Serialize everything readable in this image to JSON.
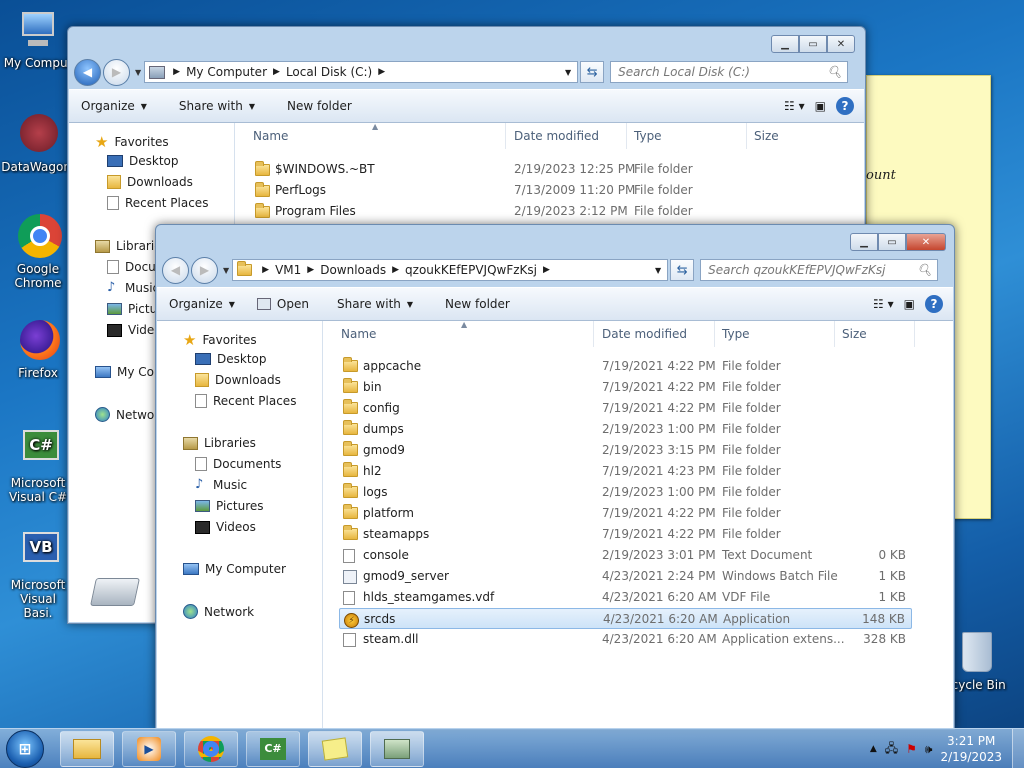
{
  "desktop": {
    "icons": [
      {
        "label": "My Comput",
        "name": "my-computer-desktop-icon"
      },
      {
        "label": "DataWagon.",
        "name": "datawagon-desktop-icon"
      },
      {
        "label": "Google Chrome",
        "name": "chrome-desktop-icon"
      },
      {
        "label": "Firefox",
        "name": "firefox-desktop-icon"
      },
      {
        "label": "Microsoft Visual C#",
        "name": "visual-csharp-desktop-icon"
      },
      {
        "label": "Microsoft Visual Basi.",
        "name": "visual-basic-desktop-icon"
      },
      {
        "label": "ecycle Bin",
        "name": "recycle-bin-desktop-icon"
      }
    ],
    "sticky_note_text": "ount"
  },
  "back_window": {
    "address": [
      "My Computer",
      "Local Disk (C:)"
    ],
    "search_placeholder": "Search Local Disk (C:)",
    "toolbar": {
      "organize": "Organize",
      "share": "Share with",
      "new_folder": "New folder"
    },
    "nav": {
      "favorites": "Favorites",
      "desktop": "Desktop",
      "downloads": "Downloads",
      "recent": "Recent Places",
      "libraries": "Librarie",
      "documents": "Docu",
      "music": "Music",
      "pictures": "Pictur",
      "videos": "Video",
      "computer": "My Cor",
      "network": "Networ"
    },
    "columns": {
      "name": "Name",
      "date": "Date modified",
      "type": "Type",
      "size": "Size"
    },
    "rows": [
      {
        "name": "$WINDOWS.~BT",
        "date": "2/19/2023 12:25 PM",
        "type": "File folder"
      },
      {
        "name": "PerfLogs",
        "date": "7/13/2009 11:20 PM",
        "type": "File folder"
      },
      {
        "name": "Program Files",
        "date": "2/19/2023 2:12 PM",
        "type": "File folder"
      }
    ]
  },
  "front_window": {
    "address": [
      "VM1",
      "Downloads",
      "qzoukKEfEPVJQwFzKsj"
    ],
    "search_placeholder": "Search qzoukKEfEPVJQwFzKsj",
    "toolbar": {
      "organize": "Organize",
      "open": "Open",
      "share": "Share with",
      "new_folder": "New folder"
    },
    "nav": {
      "favorites": "Favorites",
      "desktop": "Desktop",
      "downloads": "Downloads",
      "recent": "Recent Places",
      "libraries": "Libraries",
      "documents": "Documents",
      "music": "Music",
      "pictures": "Pictures",
      "videos": "Videos",
      "computer": "My Computer",
      "network": "Network"
    },
    "columns": {
      "name": "Name",
      "date": "Date modified",
      "type": "Type",
      "size": "Size"
    },
    "rows": [
      {
        "name": "appcache",
        "date": "7/19/2021 4:22 PM",
        "type": "File folder",
        "size": "",
        "icon": "folder"
      },
      {
        "name": "bin",
        "date": "7/19/2021 4:22 PM",
        "type": "File folder",
        "size": "",
        "icon": "folder"
      },
      {
        "name": "config",
        "date": "7/19/2021 4:22 PM",
        "type": "File folder",
        "size": "",
        "icon": "folder"
      },
      {
        "name": "dumps",
        "date": "2/19/2023 1:00 PM",
        "type": "File folder",
        "size": "",
        "icon": "folder"
      },
      {
        "name": "gmod9",
        "date": "2/19/2023 3:15 PM",
        "type": "File folder",
        "size": "",
        "icon": "folder"
      },
      {
        "name": "hl2",
        "date": "7/19/2021 4:23 PM",
        "type": "File folder",
        "size": "",
        "icon": "folder"
      },
      {
        "name": "logs",
        "date": "2/19/2023 1:00 PM",
        "type": "File folder",
        "size": "",
        "icon": "folder"
      },
      {
        "name": "platform",
        "date": "7/19/2021 4:22 PM",
        "type": "File folder",
        "size": "",
        "icon": "folder"
      },
      {
        "name": "steamapps",
        "date": "7/19/2021 4:22 PM",
        "type": "File folder",
        "size": "",
        "icon": "folder"
      },
      {
        "name": "console",
        "date": "2/19/2023 3:01 PM",
        "type": "Text Document",
        "size": "0 KB",
        "icon": "doc"
      },
      {
        "name": "gmod9_server",
        "date": "4/23/2021 2:24 PM",
        "type": "Windows Batch File",
        "size": "1 KB",
        "icon": "bat"
      },
      {
        "name": "hlds_steamgames.vdf",
        "date": "4/23/2021 6:20 AM",
        "type": "VDF File",
        "size": "1 KB",
        "icon": "doc"
      },
      {
        "name": "srcds",
        "date": "4/23/2021 6:20 AM",
        "type": "Application",
        "size": "148 KB",
        "icon": "app",
        "selected": true
      },
      {
        "name": "steam.dll",
        "date": "4/23/2021 6:20 AM",
        "type": "Application extens...",
        "size": "328 KB",
        "icon": "dll"
      }
    ]
  },
  "taskbar": {
    "time": "3:21 PM",
    "date": "2/19/2023"
  }
}
